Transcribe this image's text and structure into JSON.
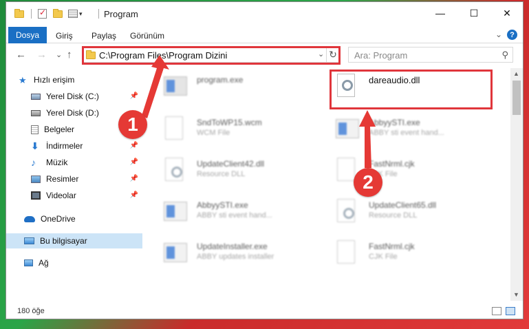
{
  "window": {
    "title": "Program",
    "minimize": "—",
    "maximize": "☐",
    "close": "✕"
  },
  "ribbon": {
    "file_tab": "Dosya",
    "tabs": [
      "Giriş",
      "Paylaş",
      "Görünüm"
    ],
    "expand": "⌄",
    "help": "?"
  },
  "nav": {
    "back": "←",
    "forward": "→",
    "recent": "⌄",
    "up": "↑",
    "address": "C:\\Program Files\\Program Dizini",
    "address_dropdown": "⌄",
    "refresh": "↻",
    "search_placeholder": "Ara: Program",
    "search_icon": "⚲"
  },
  "sidebar": {
    "items": [
      {
        "label": "Hızlı erişim",
        "icon": "star-icon"
      },
      {
        "label": "Yerel Disk (C:)",
        "icon": "drive-icon",
        "pinned": true
      },
      {
        "label": "Yerel Disk (D:)",
        "icon": "drive-icon"
      },
      {
        "label": "Belgeler",
        "icon": "documents-icon"
      },
      {
        "label": "İndirmeler",
        "icon": "download-icon",
        "pinned": true
      },
      {
        "label": "Müzik",
        "icon": "music-icon",
        "pinned": true
      },
      {
        "label": "Resimler",
        "icon": "pictures-icon",
        "pinned": true
      },
      {
        "label": "Videolar",
        "icon": "videos-icon",
        "pinned": true
      },
      {
        "label": "OneDrive",
        "icon": "cloud-icon"
      },
      {
        "label": "Bu bilgisayar",
        "icon": "computer-icon",
        "selected": true
      },
      {
        "label": "Ağ",
        "icon": "network-icon"
      }
    ],
    "pin_glyph": "📌"
  },
  "files": [
    {
      "name": "program.exe",
      "sub": "",
      "icon": "exe-icon",
      "blurred": true
    },
    {
      "name": "dareaudio.dll",
      "sub": "",
      "icon": "dll-gear-icon",
      "blurred": false,
      "highlighted": true
    },
    {
      "name": "SndToWP15.wcm",
      "sub": "WCM File",
      "icon": "doc-icon",
      "blurred": true
    },
    {
      "name": "AbbyySTI.exe",
      "sub": "ABBY sti event hand...",
      "icon": "app-icon",
      "blurred": true
    },
    {
      "name": "UpdateClient42.dll",
      "sub": "Resource DLL",
      "icon": "dll-gear-icon",
      "blurred": true
    },
    {
      "name": "FastNrml.cjk",
      "sub": "CJK File",
      "icon": "doc-icon",
      "blurred": true
    },
    {
      "name": "AbbyySTI.exe",
      "sub": "ABBY sti event hand...",
      "icon": "app-icon",
      "blurred": true
    },
    {
      "name": "UpdateClient65.dll",
      "sub": "Resource DLL",
      "icon": "dll-gear-icon",
      "blurred": true
    },
    {
      "name": "UpdateInstaller.exe",
      "sub": "ABBY updates installer",
      "icon": "app-icon",
      "blurred": true
    },
    {
      "name": "FastNrml.cjk",
      "sub": "CJK File",
      "icon": "doc-icon",
      "blurred": true
    }
  ],
  "status": {
    "item_count": "180 öğe"
  },
  "annotations": {
    "step1": "1",
    "step2": "2",
    "color": "#e53935"
  }
}
